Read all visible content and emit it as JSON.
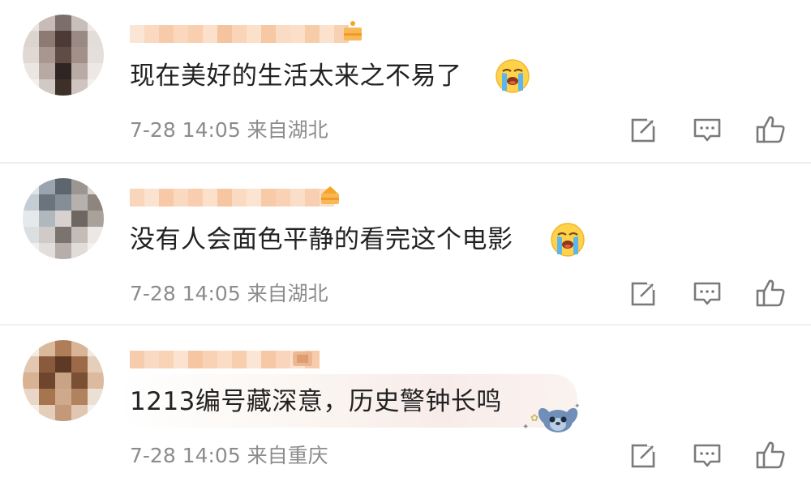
{
  "comments": [
    {
      "text": "现在美好的生活太来之不易了",
      "meta": "7-28 14:05 来自湖北",
      "emoji": "loudly-crying-face",
      "avatar_colors": [
        "#e9e4e2",
        "#c8bcb6",
        "#7c6e6a",
        "#c9bfba",
        "#eee9e6",
        "#dcd4cf",
        "#8d7a72",
        "#4b3a35",
        "#9a8a84",
        "#e3ddd9",
        "#e1d8d3",
        "#a79790",
        "#5e4c45",
        "#a39189",
        "#e5dfdb",
        "#ece6e2",
        "#b7aaa4",
        "#2f2522",
        "#b8aaa4",
        "#ede8e5",
        "#f3efed",
        "#d3c9c4",
        "#3d302b",
        "#cfc4bf",
        "#f4f0ee"
      ],
      "name_colors": [
        "#fbe6d5",
        "#fad9c0",
        "#f7cba9",
        "#fbd7bd",
        "#f9cfb0",
        "#fbe1cc",
        "#f5c39e",
        "#f9d4b8",
        "#fbe0ca",
        "#f6c8a4",
        "#fadbc3",
        "#fbdfc8",
        "#f7cda9",
        "#fbe2ce",
        "#f8d0b2"
      ],
      "vip_color": "#f5a623"
    },
    {
      "text": "没有人会面色平静的看完这个电影",
      "meta": "7-28 14:05 来自湖北",
      "emoji": "loudly-crying-face",
      "avatar_colors": [
        "#dfe3e8",
        "#9aa4ae",
        "#5d666f",
        "#9c9692",
        "#d8d4d0",
        "#c5cdd4",
        "#6b747c",
        "#848e96",
        "#b7b1ad",
        "#8f857f",
        "#e6e9ec",
        "#b0b7bd",
        "#d7d2cf",
        "#6e6660",
        "#aaa19b",
        "#dcdfe2",
        "#d0cbc8",
        "#7b736e",
        "#c4bcb6",
        "#ebe8e6",
        "#f0f0f0",
        "#e1dedc",
        "#b5aeaa",
        "#e0dcd9",
        "#f3f2f1"
      ],
      "name_colors": [
        "#f9d5ba",
        "#fbe3cf",
        "#f7c9a6",
        "#fad9c1",
        "#f8ceaf",
        "#fbe0ca",
        "#f6c6a1",
        "#fadbc2",
        "#fbe4d1",
        "#f7cba8",
        "#f9d2b5",
        "#fbdec7",
        "#f8cfb0",
        "#fadcc4"
      ],
      "vip_color": "#f5a623"
    },
    {
      "text": "1213编号藏深意，历史警钟长鸣",
      "meta": "7-28 14:05 来自重庆",
      "emoji": "stitch-sticker",
      "avatar_colors": [
        "#f4ebe3",
        "#d9b99c",
        "#b07d59",
        "#d8b596",
        "#f3e9e0",
        "#e3c7ae",
        "#8a5a3c",
        "#5e3a26",
        "#9c6a48",
        "#e6cfba",
        "#d7b293",
        "#6f462d",
        "#c9a386",
        "#7a4f33",
        "#dbbaa0",
        "#e9d6c6",
        "#a6754f",
        "#cfa98b",
        "#b08260",
        "#ece0d5",
        "#f6efe9",
        "#e4cdb9",
        "#c49979",
        "#e1c7b1",
        "#f7f1ec"
      ],
      "name_colors": [
        "#f7ccad",
        "#fadac3",
        "#f9d3b6",
        "#fbe3cf",
        "#f6c6a3",
        "#f9d1b4",
        "#fbdcc5",
        "#f8cfae",
        "#fbe6d5",
        "#f7c8a5",
        "#f9d6bb",
        "#fbe1cb",
        "#f8ccab"
      ],
      "vip_color": "#e8b08a"
    }
  ],
  "action_icons": [
    "share-icon",
    "comment-icon",
    "like-icon"
  ],
  "colors": {
    "text": "#222222",
    "meta": "#8c8c8c",
    "icon": "#7a7a7a",
    "divider": "#efefef"
  }
}
